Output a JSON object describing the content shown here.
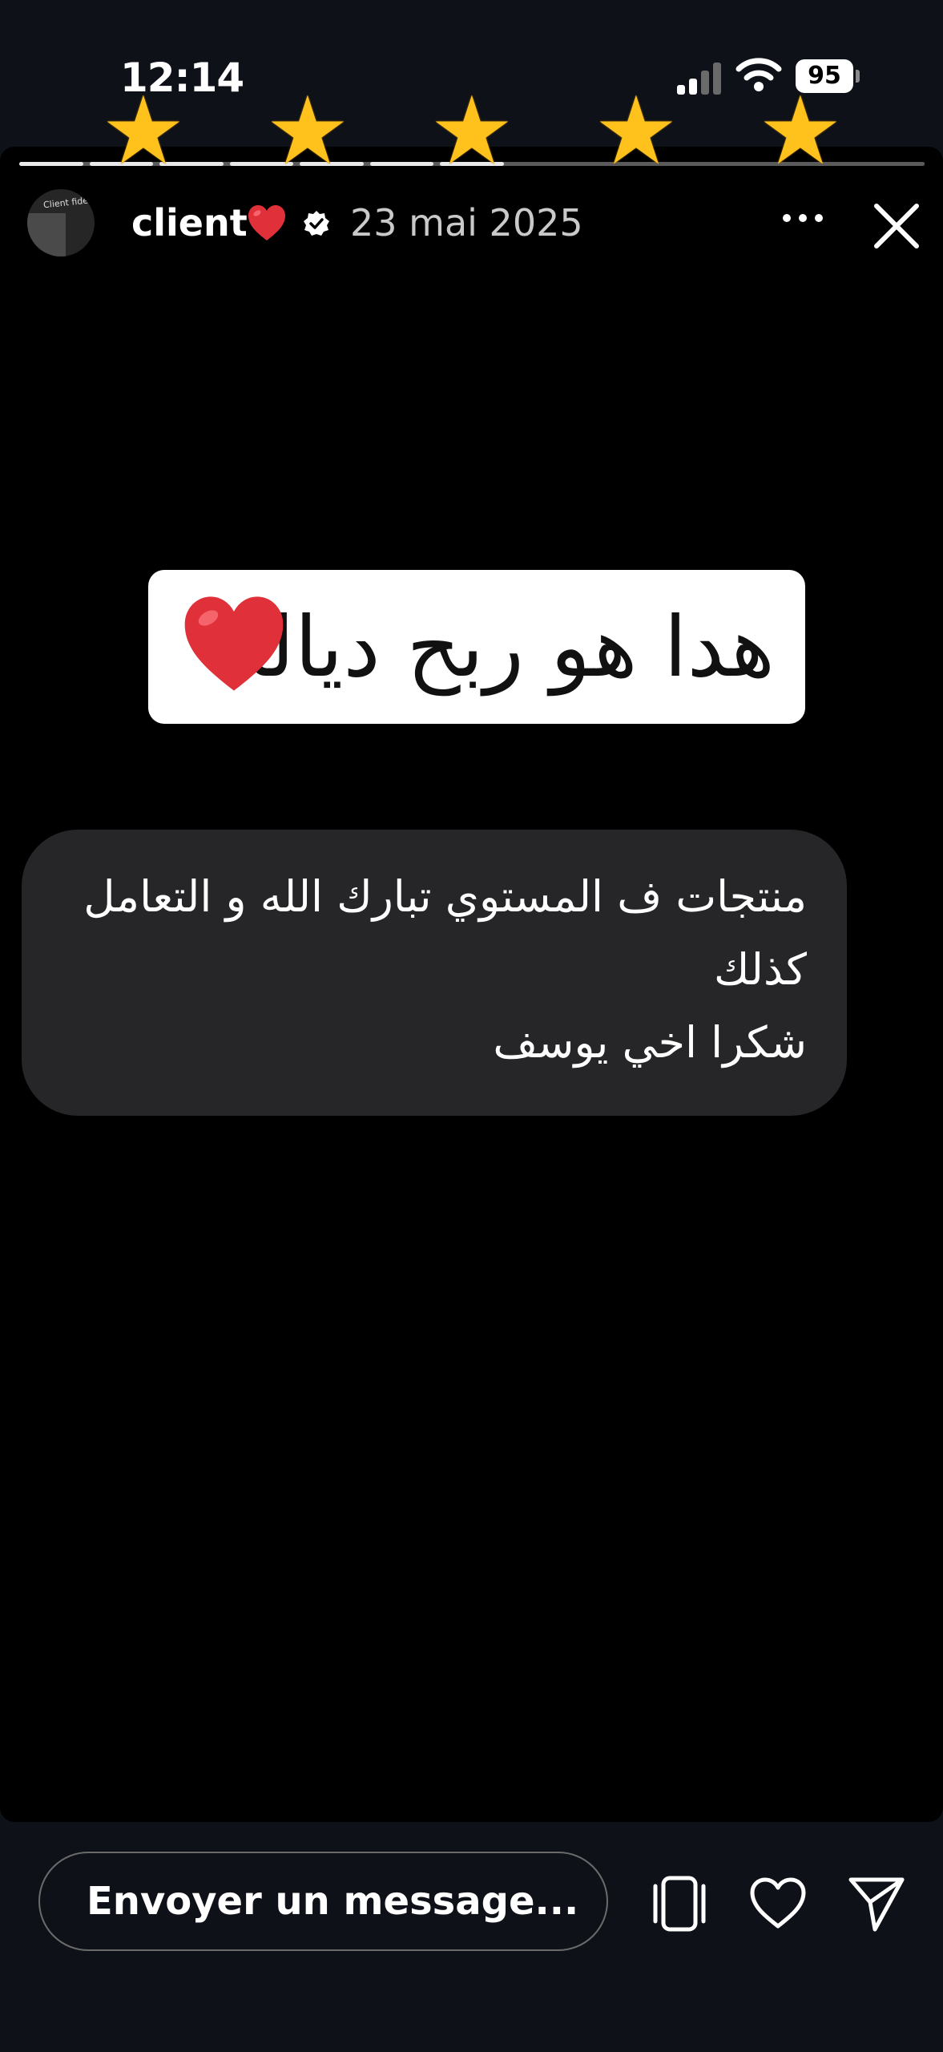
{
  "status_bar": {
    "time": "12:14",
    "battery": "95"
  },
  "overlay": {
    "stars": [
      "★",
      "★",
      "★",
      "★",
      "★"
    ],
    "star_color": "#ffc21d"
  },
  "story": {
    "username": "client",
    "username_emoji": "❤️",
    "date": "23 mai 2025",
    "background": "#000000",
    "segments_total": 13,
    "segments_viewed": 7
  },
  "sticker": {
    "text": "هدا هو ربح ديالنا",
    "emoji": "❤️"
  },
  "message_bubble": {
    "lines": [
      "منتجات ف المستوي تبارك الله و التعامل",
      "كذلك",
      "شكرا اخي يوسف"
    ]
  },
  "footer": {
    "message_placeholder": "Envoyer un message..."
  },
  "icons": {
    "signal": "signal-icon",
    "wifi": "wifi-icon",
    "battery": "battery-icon",
    "verified": "verified-badge-icon",
    "more": "more-options-icon",
    "close": "close-icon",
    "overlays": "layers-icon",
    "like": "heart-icon",
    "share": "send-icon"
  }
}
